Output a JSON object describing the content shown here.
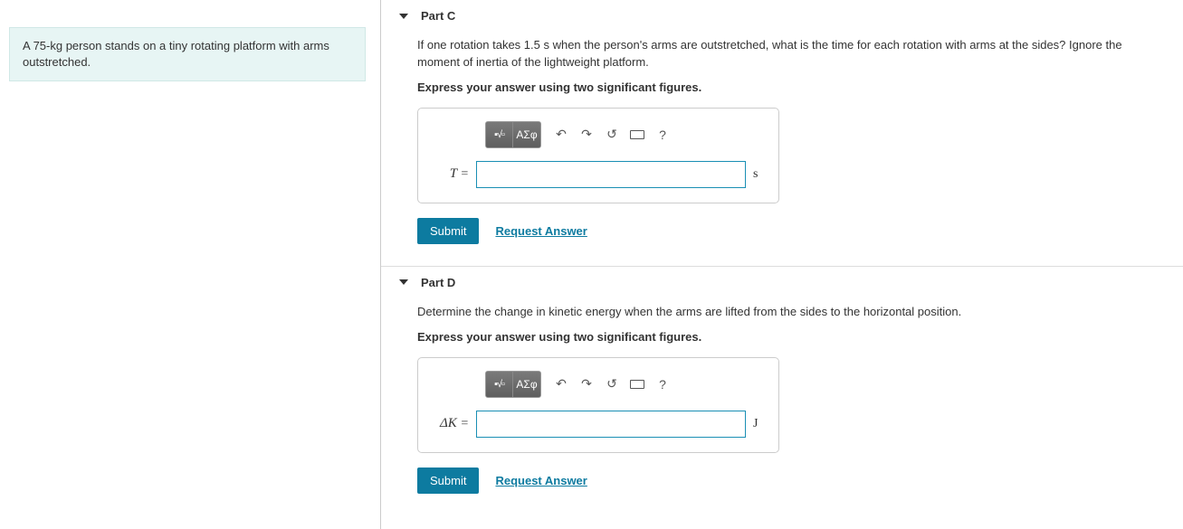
{
  "problem": {
    "statement": "A 75-kg person stands on a tiny rotating platform with arms outstretched."
  },
  "parts": [
    {
      "label": "Part C",
      "question": "If one rotation takes 1.5 s when the person's arms are outstretched, what is the time for each rotation with arms at the sides? Ignore the moment of inertia of the lightweight platform.",
      "instruction": "Express your answer using two significant figures.",
      "variable": "T",
      "equals": "=",
      "unit": "s",
      "value": "",
      "submit_label": "Submit",
      "request_label": "Request Answer",
      "toolbar": {
        "greek_label": "ΑΣφ",
        "help_label": "?"
      }
    },
    {
      "label": "Part D",
      "question": "Determine the change in kinetic energy when the arms are lifted from the sides to the horizontal position.",
      "instruction": "Express your answer using two significant figures.",
      "variable": "ΔK",
      "equals": "=",
      "unit": "J",
      "value": "",
      "submit_label": "Submit",
      "request_label": "Request Answer",
      "toolbar": {
        "greek_label": "ΑΣφ",
        "help_label": "?"
      }
    }
  ]
}
